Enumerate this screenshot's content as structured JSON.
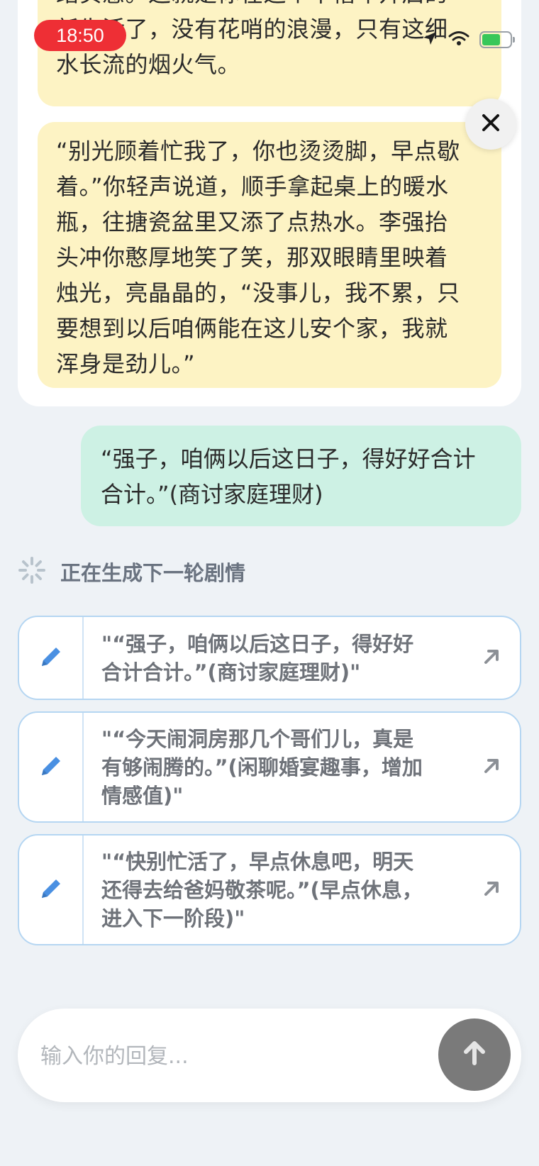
{
  "status_bar": {
    "time": "18:50",
    "battery_color": "#37c759"
  },
  "story": {
    "paragraph_1_lines": [
      "踏实感。这就是你在这个千禧年开启的",
      "新生活了，没有花哨的浪漫，只有这细",
      "水长流的烟火气。"
    ],
    "paragraph_2_lines": [
      "“别光顾着忙我了，你也烫烫脚，早点歇",
      "着。”你轻声说道，顺手拿起桌上的暖水",
      "瓶，往搪瓷盆里又添了点热水。李强抬",
      "头冲你憨厚地笑了笑，那双眼睛里映着",
      "烛光，亮晶晶的，“没事儿，我不累，只",
      "要想到以后咱俩能在这儿安个家，我就",
      "浑身是劲儿。”"
    ]
  },
  "user_message": {
    "lines": [
      "“强子，咱俩以后这日子，得好好合计",
      "合计。”(商讨家庭理财)"
    ]
  },
  "generating": {
    "label": "正在生成下一轮剧情"
  },
  "options": [
    {
      "lines": [
        "\"“强子，咱俩以后这日子，得好好",
        "合计合计。”(商讨家庭理财)\""
      ]
    },
    {
      "lines": [
        "\"“今天闹洞房那几个哥们儿，真是",
        "有够闹腾的。”(闲聊婚宴趣事，增加",
        "情感值)\""
      ]
    },
    {
      "lines": [
        "\"“快别忙活了，早点休息吧，明天",
        "还得去给爸妈敬茶呢。”(早点休息，",
        "进入下一阶段)\""
      ]
    }
  ],
  "input": {
    "placeholder": "输入你的回复..."
  },
  "icons": {
    "close": "close-icon",
    "edit": "pencil-icon",
    "arrow": "arrow-up-right-icon",
    "send": "arrow-up-icon",
    "spinner": "spinner-icon"
  },
  "colors": {
    "story_bg": "#fdf3c4",
    "user_bubble_bg": "#cdf1e4",
    "option_border": "#b5d6f2",
    "edit_icon": "#4a90e2",
    "send_button": "#7a7a7a",
    "status_pill": "#ee2f35"
  }
}
